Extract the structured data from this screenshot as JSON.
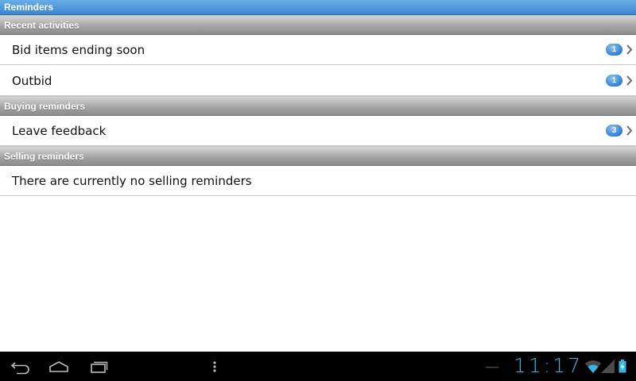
{
  "app": {
    "title": "Reminders"
  },
  "sections": [
    {
      "header": "Recent activities",
      "rows": [
        {
          "label": "Bid items ending soon",
          "count": "1"
        },
        {
          "label": "Outbid",
          "count": "1"
        }
      ]
    },
    {
      "header": "Buying reminders",
      "rows": [
        {
          "label": "Leave feedback",
          "count": "3"
        }
      ]
    },
    {
      "header": "Selling reminders",
      "rows": [
        {
          "label": "There are currently no selling reminders"
        }
      ]
    }
  ],
  "system_bar": {
    "clock": "11:17",
    "icons": [
      "back-icon",
      "home-icon",
      "recent-apps-icon",
      "menu-icon",
      "wifi-icon",
      "signal-icon",
      "battery-icon"
    ]
  },
  "colors": {
    "title_bar": "#3a86d0",
    "badge": "#2f7fd0",
    "clock": "#33b5e5",
    "header_gray": "#a5a5a5"
  }
}
